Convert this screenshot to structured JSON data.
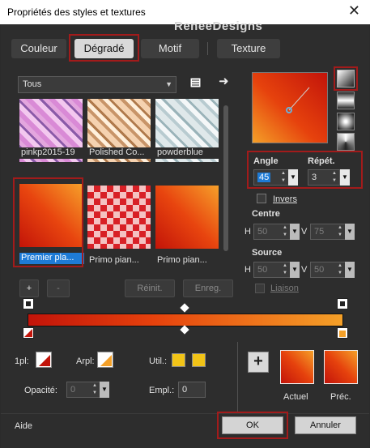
{
  "window": {
    "title": "Propriétés des styles et textures",
    "close": "✕"
  },
  "watermark": "ReneeDesigns",
  "tabs": [
    {
      "label": "Couleur"
    },
    {
      "label": "Dégradé"
    },
    {
      "label": "Motif"
    },
    {
      "label": "Texture"
    }
  ],
  "library": {
    "category": "Tous",
    "items": [
      {
        "label": "pinkp2015-19"
      },
      {
        "label": "Polished Co..."
      },
      {
        "label": "powderblue"
      },
      {
        "label": "Premier pla..."
      },
      {
        "label": "Primo pian..."
      },
      {
        "label": "Primo pian..."
      }
    ],
    "add": "+",
    "remove": "-",
    "reset": "Réinit.",
    "save": "Enreg."
  },
  "gradient": {
    "angle_label": "Angle",
    "angle_value": "45",
    "repeat_label": "Répét.",
    "repeat_value": "3",
    "invert_label": "Invers",
    "center_label": "Centre",
    "center_h_label": "H",
    "center_h": "50",
    "center_v_label": "V",
    "center_v": "75",
    "source_label": "Source",
    "source_h_label": "H",
    "source_h": "50",
    "source_v_label": "V",
    "source_v": "50",
    "link_label": "Liaison"
  },
  "bottom": {
    "fg_label": "1pl:",
    "bg_label": "Arpl:",
    "user_label": "Util.:",
    "opacity_label": "Opacité:",
    "opacity_value": "0",
    "location_label": "Empl.:",
    "location_value": "0",
    "current_label": "Actuel",
    "previous_label": "Préc.",
    "add": "+"
  },
  "footer": {
    "help": "Aide",
    "ok": "OK",
    "cancel": "Annuler"
  },
  "colors": {
    "accent": "#a21b1b",
    "selection": "#1e7bd6",
    "gradient_start": "#cc1a0c",
    "gradient_end": "#f4a028"
  }
}
